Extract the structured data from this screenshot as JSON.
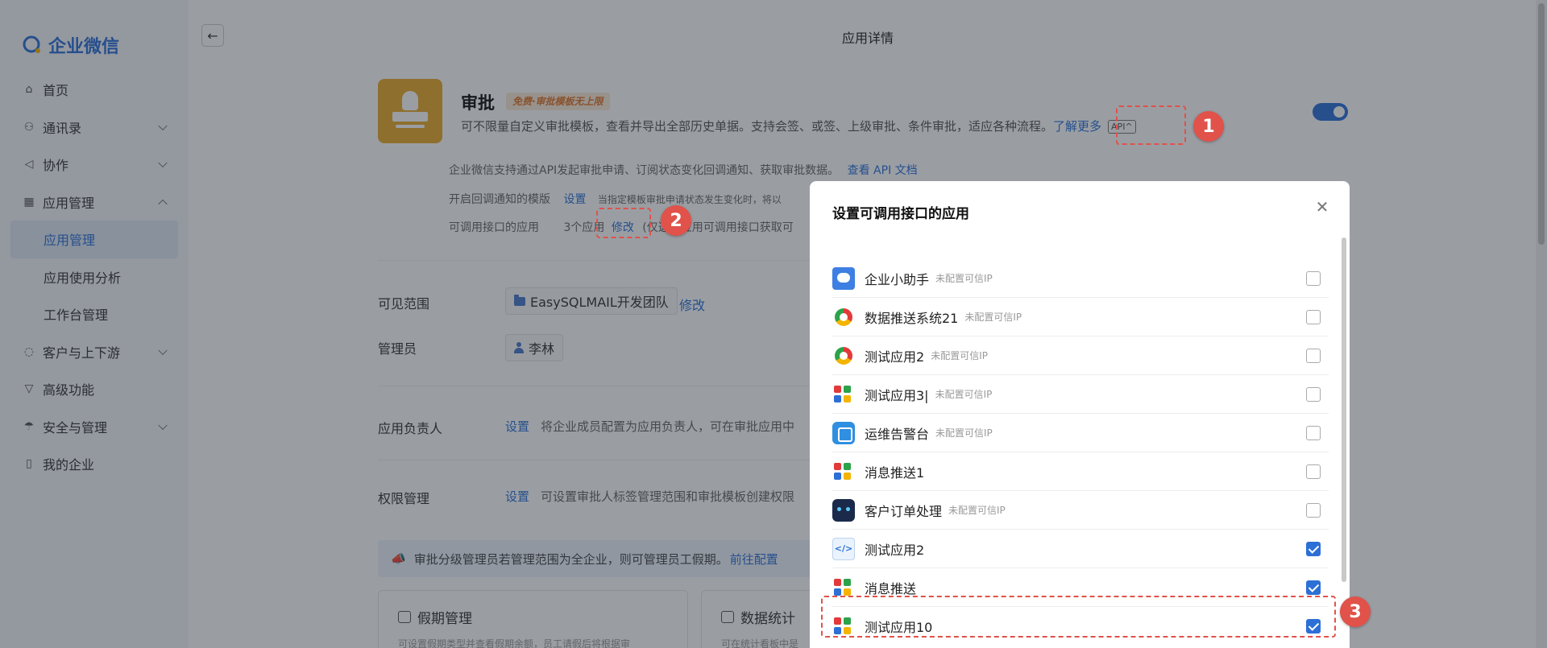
{
  "sidebar": {
    "logo": "企业微信",
    "items": [
      {
        "label": "首页",
        "icon": "home-icon"
      },
      {
        "label": "通讯录",
        "icon": "contacts-icon",
        "expandable": true
      },
      {
        "label": "协作",
        "icon": "collab-icon",
        "expandable": true
      },
      {
        "label": "应用管理",
        "icon": "apps-grid-icon",
        "expanded": true
      },
      {
        "label": "应用管理",
        "sub": true,
        "active": true
      },
      {
        "label": "应用使用分析",
        "sub": true
      },
      {
        "label": "工作台管理",
        "sub": true
      },
      {
        "label": "客户与上下游",
        "icon": "chat-icon",
        "expandable": true
      },
      {
        "label": "高级功能",
        "icon": "funnel-icon"
      },
      {
        "label": "安全与管理",
        "icon": "umbrella-icon",
        "expandable": true
      },
      {
        "label": "我的企业",
        "icon": "building-icon"
      }
    ]
  },
  "header": {
    "title": "应用详情"
  },
  "app": {
    "name": "审批",
    "badge": "免费·审批模板无上限",
    "description": "可不限量自定义审批模板，查看并导出全部历史单据。支持会签、或签、上级审批、条件审批，适应各种流程。",
    "learn_more": "了解更多",
    "api_tag": "API^",
    "api_line": "企业微信支持通过API发起审批申请、订阅状态变化回调通知、获取审批数据。",
    "api_doc_link": "查看 API 文档",
    "callback_label": "开启回调通知的模版",
    "callback_link": "设置",
    "callback_desc": "当指定模板审批申请状态发生变化时，将以",
    "callable_label": "可调用接口的应用",
    "callable_count": "3个应用",
    "callable_link": "修改",
    "callable_desc": "(仅这些应用可调用接口获取可"
  },
  "visibility": {
    "label": "可见范围",
    "team": "EasySQLMAIL开发团队",
    "edit": "修改"
  },
  "admin": {
    "label": "管理员",
    "name": "李林"
  },
  "owner": {
    "label": "应用负责人",
    "link": "设置",
    "desc": "将企业成员配置为应用负责人，可在审批应用中"
  },
  "permission": {
    "label": "权限管理",
    "link": "设置",
    "desc": "可设置审批人标签管理范围和审批模板创建权限"
  },
  "notice": {
    "text": "审批分级管理员若管理范围为全企业，则可管理员工假期。",
    "link": "前往配置"
  },
  "cards": [
    {
      "title": "假期管理",
      "sub": "可设置假期类型并查看假期余额，员工请假后将根据审"
    },
    {
      "title": "数据统计",
      "sub": "可在统计看板中是"
    }
  ],
  "modal": {
    "title": "设置可调用接口的应用",
    "untrusted_tag": "未配置可信IP",
    "apps": [
      {
        "name": "企业小助手",
        "icon": "blue-chat",
        "untrusted": true,
        "checked": false
      },
      {
        "name": "数据推送系统21",
        "icon": "ring",
        "untrusted": true,
        "checked": false
      },
      {
        "name": "测试应用2",
        "icon": "ring",
        "untrusted": true,
        "checked": false
      },
      {
        "name": "测试应用3|",
        "icon": "blocks",
        "untrusted": true,
        "checked": false
      },
      {
        "name": "运维告警台",
        "icon": "box",
        "untrusted": true,
        "checked": false
      },
      {
        "name": "消息推送1",
        "icon": "blocks",
        "untrusted": false,
        "checked": false
      },
      {
        "name": "客户订单处理",
        "icon": "robot",
        "untrusted": true,
        "checked": false
      },
      {
        "name": "测试应用2",
        "icon": "code",
        "untrusted": false,
        "checked": true
      },
      {
        "name": "消息推送",
        "icon": "blocks",
        "untrusted": false,
        "checked": true
      },
      {
        "name": "测试应用10",
        "icon": "blocks",
        "untrusted": false,
        "checked": true
      }
    ]
  },
  "markers": [
    "1",
    "2",
    "3"
  ],
  "colors": {
    "accent": "#2c6fd6",
    "annotation": "#e0524a",
    "app_icon": "#e9a92a"
  }
}
